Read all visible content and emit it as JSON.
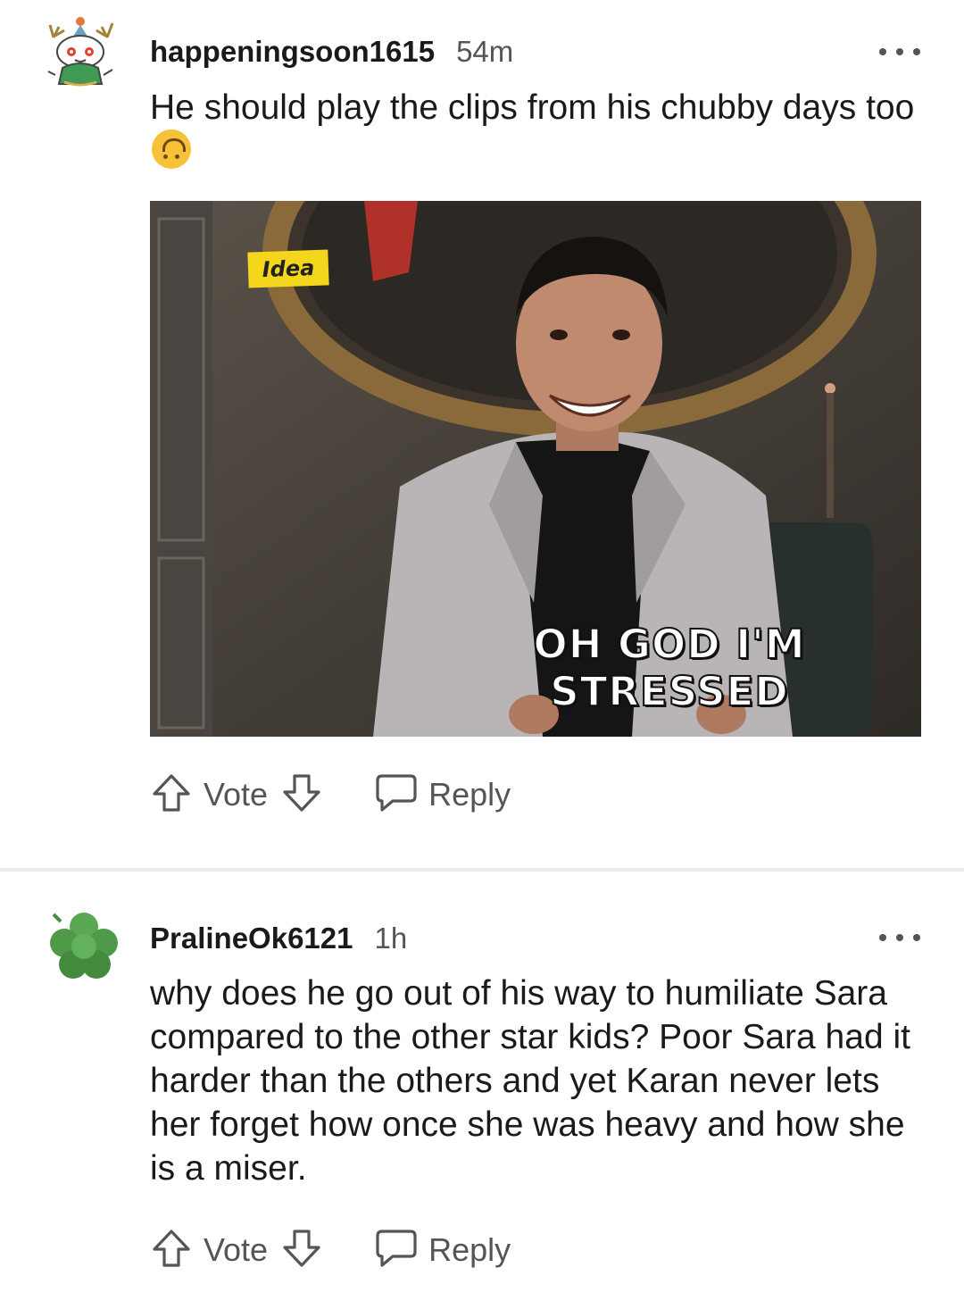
{
  "comments": [
    {
      "username": "happeningsoon1615",
      "age": "54m",
      "text": "He should play the clips from his chubby days too",
      "emoji": "upside-down-face",
      "media": {
        "logo_text": "Idea",
        "caption": "OH GOD I'M STRESSED"
      },
      "vote_label": "Vote",
      "reply_label": "Reply"
    },
    {
      "username": "PralineOk6121",
      "age": "1h",
      "text": "why does he go out of his way to humiliate Sara compared to the other star kids? Poor Sara had it harder than the others and yet Karan never lets her forget how once she was heavy and how she is a miser.",
      "vote_label": "Vote",
      "reply_label": "Reply"
    }
  ],
  "colors": {
    "text": "#1a1a1b",
    "meta": "#555555",
    "divider": "#ececec",
    "avatar2": "#4e9a48"
  },
  "icons": [
    "snoo-avatar-icon",
    "clover-avatar-icon",
    "more-options-icon",
    "upvote-icon",
    "downvote-icon",
    "reply-icon"
  ]
}
